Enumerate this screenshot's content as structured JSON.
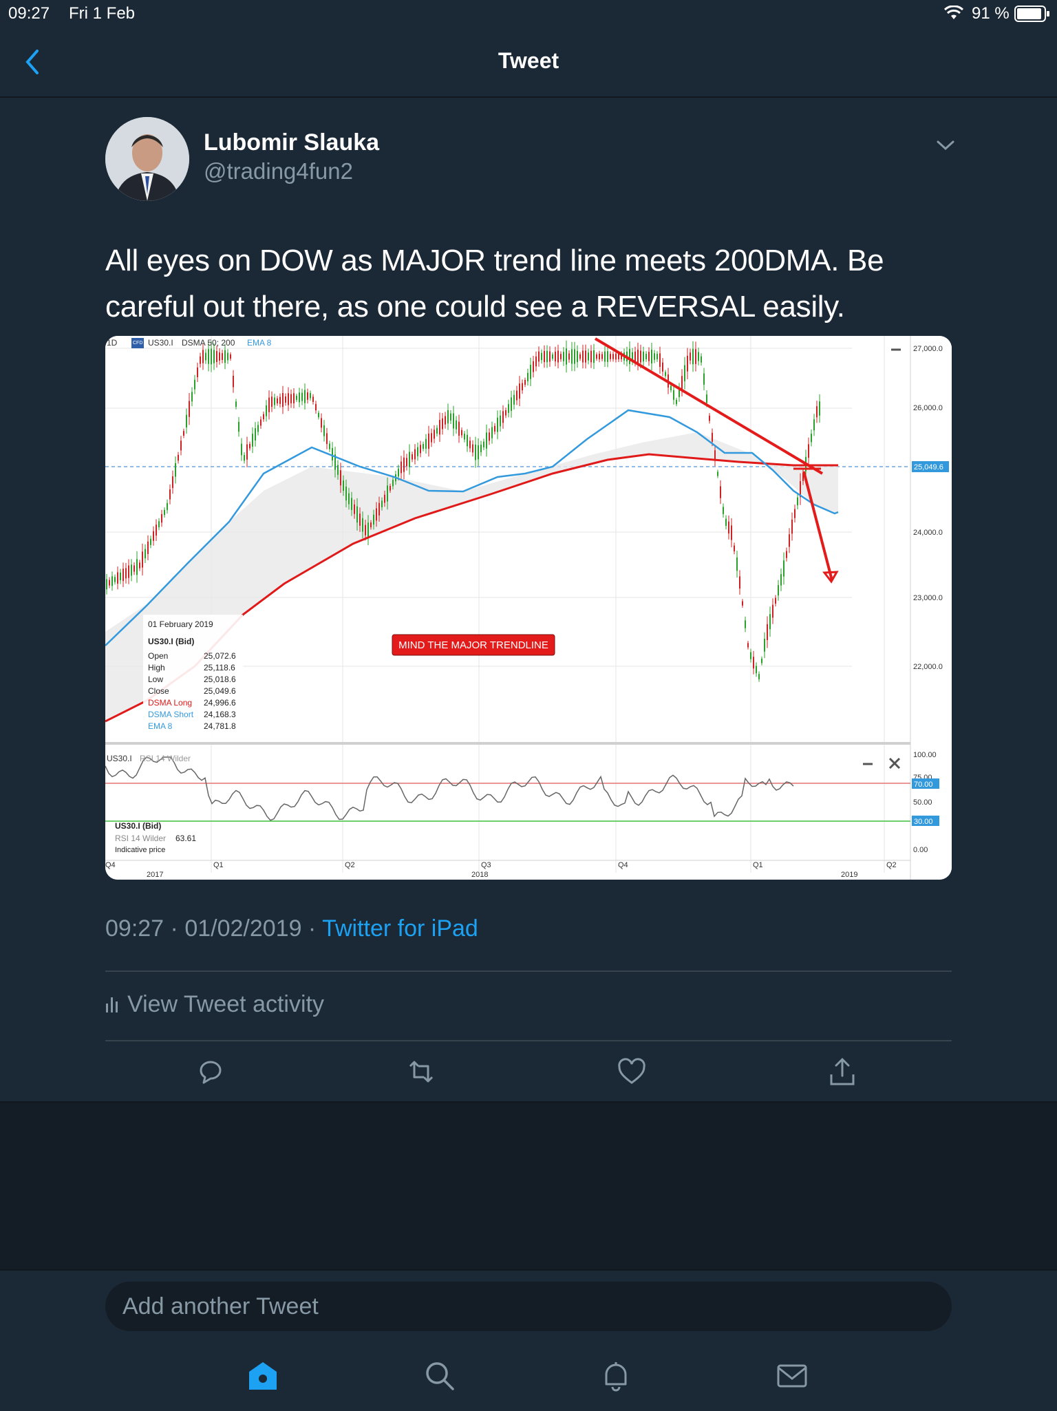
{
  "status_bar": {
    "time": "09:27",
    "date": "Fri 1 Feb",
    "battery": "91 %"
  },
  "nav": {
    "title": "Tweet",
    "back_icon": "chevron-left-icon"
  },
  "tweet": {
    "author_name": "Lubomir Slauka",
    "author_handle": "@trading4fun2",
    "text": "All eyes on DOW as MAJOR trend line meets 200DMA. Be careful out there, as one could see a REVERSAL easily.",
    "time": "09:27",
    "sep1": " · ",
    "date": "01/02/2019",
    "sep2": " · ",
    "source": "Twitter for iPad",
    "activity_label": "View Tweet activity"
  },
  "chart": {
    "header": {
      "interval": "1D",
      "badge": "CFD",
      "symbol": "US30.I",
      "indicators": "DSMA 50; 200",
      "ema": "EMA 8"
    },
    "price_ticks": [
      "27,000.0",
      "26,000.0",
      "25,049.6",
      "24,000.0",
      "23,000.0",
      "22,000.0"
    ],
    "tooltip": {
      "date": "01 February 2019",
      "symbol": "US30.I (Bid)",
      "rows": [
        {
          "label": "Open",
          "value": "25,072.6"
        },
        {
          "label": "High",
          "value": "25,118.6"
        },
        {
          "label": "Low",
          "value": "25,018.6"
        },
        {
          "label": "Close",
          "value": "25,049.6"
        },
        {
          "label": "DSMA Long",
          "value": "24,996.6"
        },
        {
          "label": "DSMA Short",
          "value": "24,168.3"
        },
        {
          "label": "EMA 8",
          "value": "24,781.8"
        }
      ]
    },
    "annotation": "MIND THE MAJOR TRENDLINE",
    "rsi": {
      "label_symbol": "US30.I",
      "label": "RSI 14 Wilder",
      "info_symbol": "US30.I (Bid)",
      "info_label": "RSI 14 Wilder",
      "info_value": "63.61",
      "info_note": "Indicative price",
      "ticks": [
        "100.00",
        "75.00",
        "70.00",
        "50.00",
        "30.00",
        "0.00"
      ]
    },
    "x_quarters": [
      "Q4",
      "Q1",
      "Q2",
      "Q3",
      "Q4",
      "Q1",
      "Q2"
    ],
    "x_years": [
      "2017",
      "2018",
      "2019"
    ],
    "colors": {
      "dsma_long": "#e01919",
      "dsma_short": "#3399dd",
      "up": "#2aa02a",
      "down": "#cc2222",
      "trendline": "#e31b1b"
    }
  },
  "actions": [
    "reply-icon",
    "retweet-icon",
    "like-icon",
    "share-icon"
  ],
  "compose": {
    "placeholder": "Add another Tweet"
  },
  "tabs": [
    "home-icon",
    "search-icon",
    "notifications-icon",
    "messages-icon"
  ]
}
